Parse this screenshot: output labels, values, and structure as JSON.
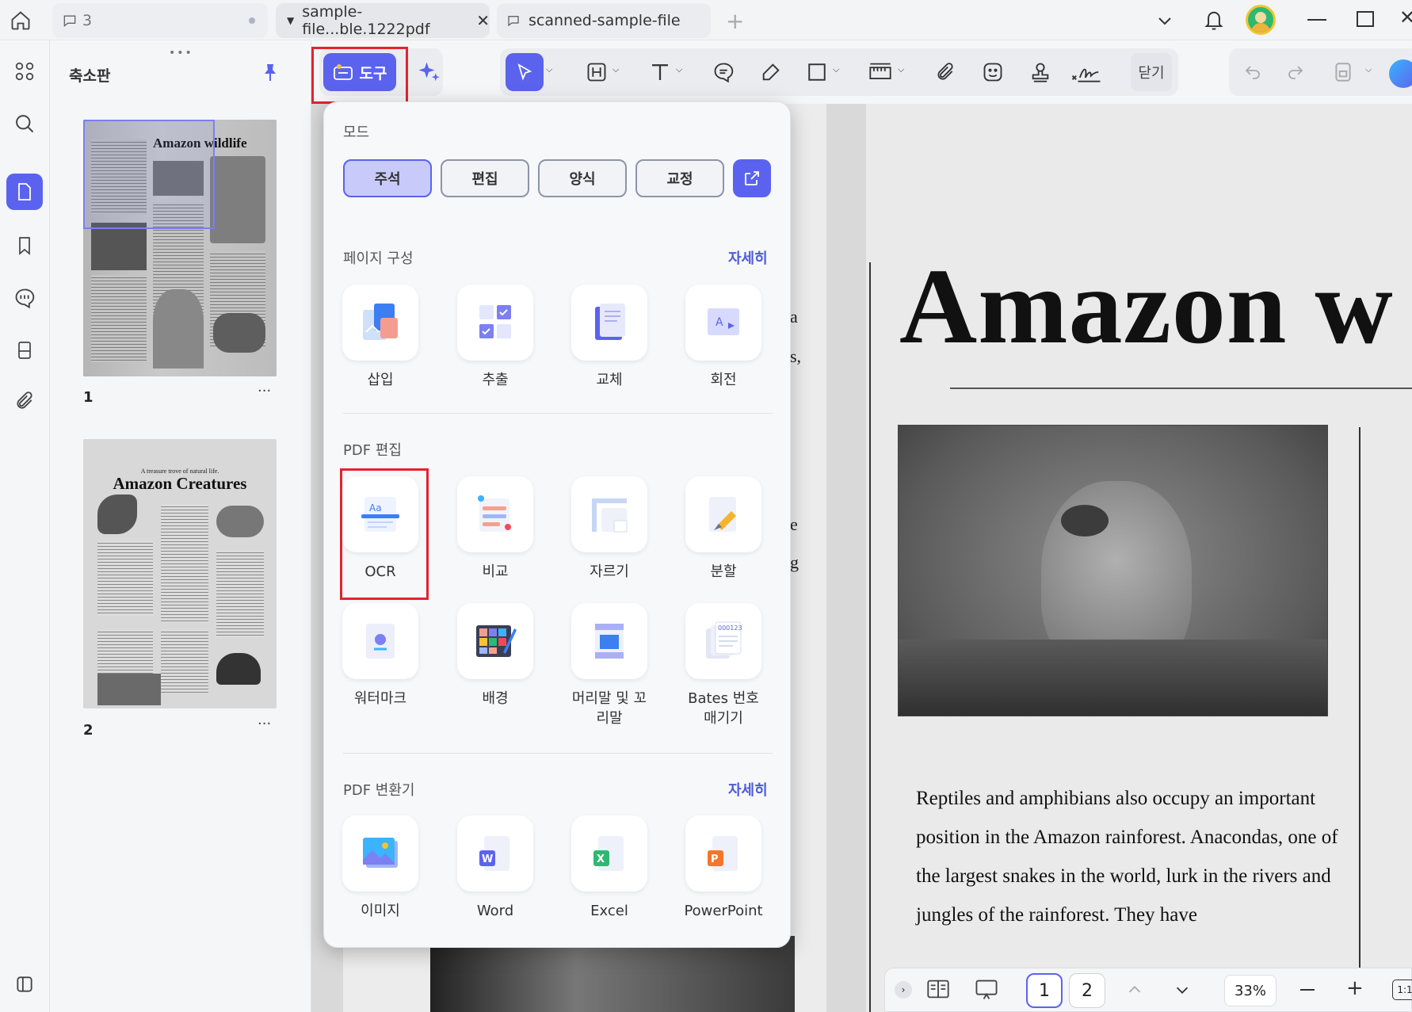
{
  "tabs": {
    "comments_count": "3",
    "active_tab": "sample-file...ble.1222pdf",
    "second_tab": "scanned-sample-file"
  },
  "sidebar": {
    "title": "축소판",
    "pages": [
      {
        "number": "1",
        "heading": "Amazon wildlife"
      },
      {
        "number": "2",
        "kicker": "A treasure trove of natural life.",
        "heading": "Amazon Creatures"
      }
    ]
  },
  "toolbar": {
    "tools_label": "도구",
    "close_label": "닫기"
  },
  "popup": {
    "mode_title": "모드",
    "modes": [
      "주석",
      "편집",
      "양식",
      "교정"
    ],
    "page_section": {
      "title": "페이지 구성",
      "more": "자세히",
      "tools": [
        "삽입",
        "추출",
        "교체",
        "회전"
      ]
    },
    "edit_section": {
      "title": "PDF 편집",
      "tools": [
        "OCR",
        "비교",
        "자르기",
        "분할",
        "워터마크",
        "배경",
        "머리말 및 꼬리말",
        "Bates 번호 매기기"
      ]
    },
    "convert_section": {
      "title": "PDF 변환기",
      "more": "자세히",
      "tools": [
        "이미지",
        "Word",
        "Excel",
        "PowerPoint"
      ]
    }
  },
  "document": {
    "title": "Amazon w",
    "body": "Reptiles and amphibians also occupy an important position in the Amazon rainforest. Anacondas, one of the largest snakes in the world, lurk in the rivers and jungles of the rainforest. They have",
    "edge_letters": [
      "a",
      "s,",
      "e",
      "g"
    ]
  },
  "bottombar": {
    "page_current": "1",
    "page_next": "2",
    "zoom": "33%",
    "fit_label": "1:1"
  },
  "colors": {
    "accent": "#5b63ee",
    "highlight_box": "#e3232f"
  }
}
